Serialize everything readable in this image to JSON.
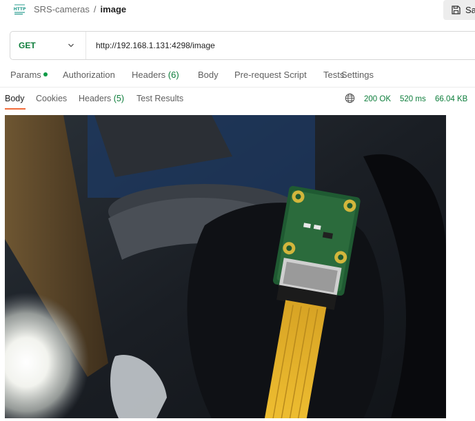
{
  "header": {
    "icon": "http-request-icon",
    "breadcrumb_parent": "SRS-cameras",
    "breadcrumb_separator": "/",
    "breadcrumb_current": "image",
    "save_label": "Sa"
  },
  "request": {
    "method": "GET",
    "url": "http://192.168.1.131:4298/image"
  },
  "request_tabs": {
    "params": "Params",
    "authorization": "Authorization",
    "headers": "Headers",
    "headers_count": "(6)",
    "body": "Body",
    "pre_request": "Pre-request Script",
    "tests": "Tests",
    "settings": "Settings"
  },
  "response_tabs": {
    "body": "Body",
    "cookies": "Cookies",
    "headers": "Headers",
    "headers_count": "(5)",
    "test_results": "Test Results",
    "active": "Body"
  },
  "response_meta": {
    "status": "200 OK",
    "time": "520 ms",
    "size": "66.04 KB"
  },
  "colors": {
    "accent_orange": "#f26b3a",
    "status_green": "#0c7d3a",
    "icon_teal": "#2a9d8f"
  }
}
